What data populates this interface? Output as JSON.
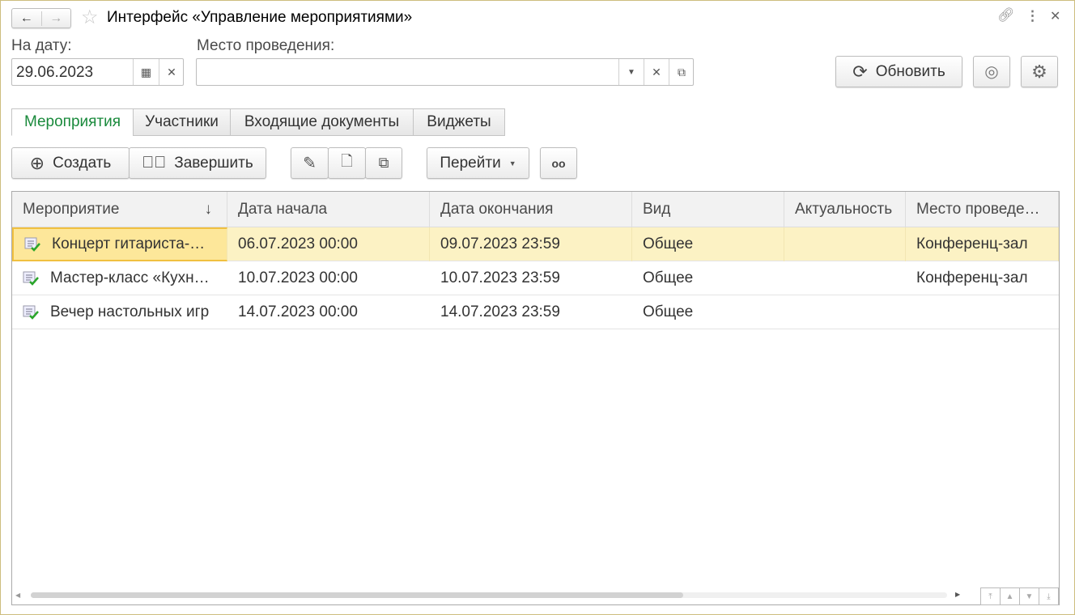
{
  "window": {
    "title": "Интерфейс «Управление мероприятиями»"
  },
  "filters": {
    "date_label": "На дату:",
    "date_value": "29.06.2023",
    "place_label": "Место проведения:",
    "place_value": ""
  },
  "actions": {
    "refresh": "Обновить"
  },
  "tabs": [
    {
      "label": "Мероприятия",
      "active": true
    },
    {
      "label": "Участники"
    },
    {
      "label": "Входящие документы"
    },
    {
      "label": "Виджеты"
    }
  ],
  "toolbar": {
    "create": "Создать",
    "finish": "Завершить",
    "goto": "Перейти"
  },
  "table": {
    "columns": [
      "Мероприятие",
      "Дата начала",
      "Дата окончания",
      "Вид",
      "Актуальность",
      "Место проведе…"
    ],
    "rows": [
      [
        "Концерт гитариста-…",
        "06.07.2023 00:00",
        "09.07.2023 23:59",
        "Общее",
        "",
        "Конференц-зал"
      ],
      [
        "Мастер-класс «Кухн…",
        "10.07.2023 00:00",
        "10.07.2023 23:59",
        "Общее",
        "",
        "Конференц-зал"
      ],
      [
        "Вечер настольных игр",
        "14.07.2023 00:00",
        "14.07.2023 23:59",
        "Общее",
        "",
        ""
      ]
    ]
  },
  "colors": {
    "accent": "#1a8a3c",
    "selection": "#fcf2c4"
  }
}
